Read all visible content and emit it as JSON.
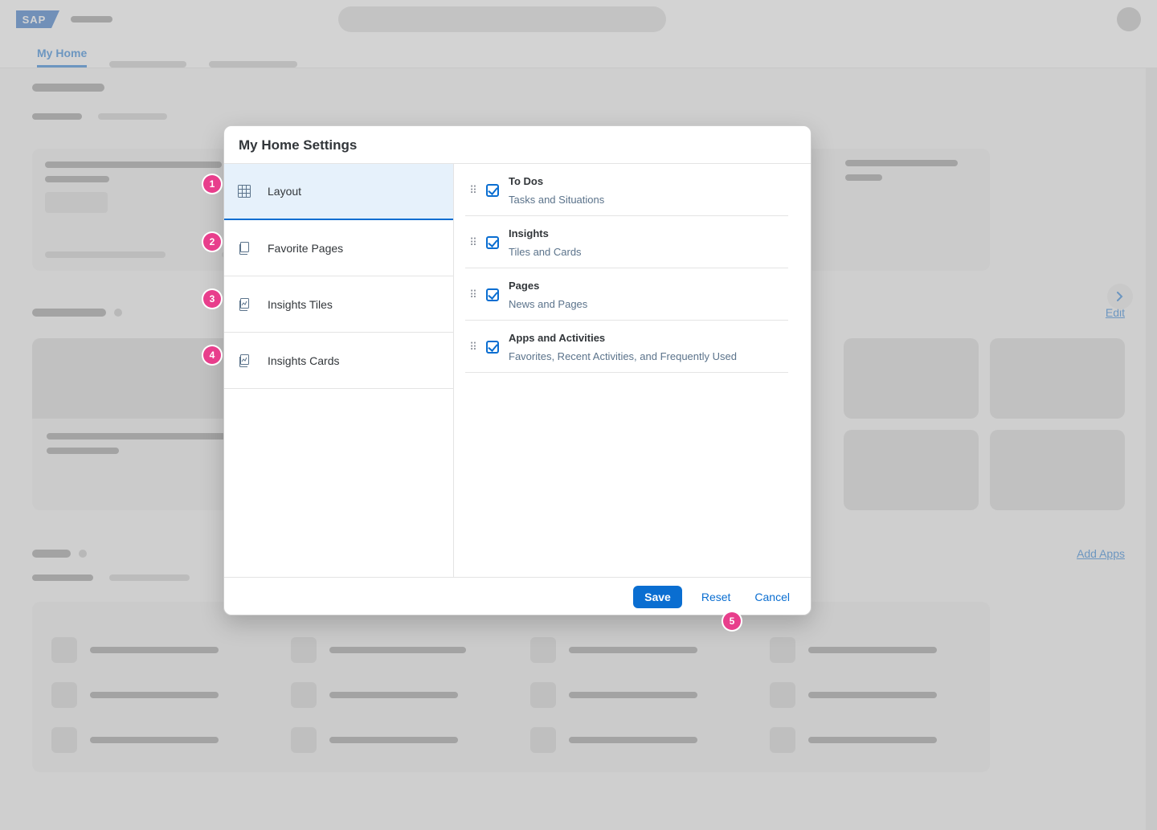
{
  "logo_text": "SAP",
  "nav": {
    "my_home": "My Home"
  },
  "links": {
    "edit": "Edit",
    "add_apps": "Add Apps"
  },
  "hotspots": [
    "1",
    "2",
    "3",
    "4",
    "5"
  ],
  "dialog": {
    "title": "My Home Settings",
    "left_items": [
      {
        "label": "Layout"
      },
      {
        "label": "Favorite Pages"
      },
      {
        "label": "Insights Tiles"
      },
      {
        "label": "Insights Cards"
      }
    ],
    "layout_rows": [
      {
        "title": "To Dos",
        "desc": "Tasks and Situations"
      },
      {
        "title": "Insights",
        "desc": "Tiles and Cards"
      },
      {
        "title": "Pages",
        "desc": "News and Pages"
      },
      {
        "title": "Apps and Activities",
        "desc": "Favorites, Recent Activities, and Frequently Used"
      }
    ],
    "footer": {
      "save": "Save",
      "reset": "Reset",
      "cancel": "Cancel"
    }
  }
}
